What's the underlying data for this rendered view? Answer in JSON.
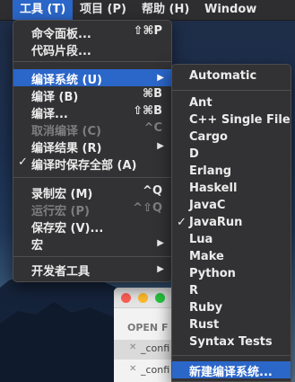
{
  "menubar": {
    "items": [
      {
        "label": "工具 (T)"
      },
      {
        "label": "项目 (P)"
      },
      {
        "label": "帮助 (H)"
      },
      {
        "label": "Window"
      }
    ]
  },
  "tools_menu": {
    "items": [
      {
        "label": "命令面板...",
        "shortcut": "⇧⌘P"
      },
      {
        "label": "代码片段..."
      },
      {
        "label": "编译系统 (U)"
      },
      {
        "label": "编译 (B)",
        "shortcut": "⌘B"
      },
      {
        "label": "编译...",
        "shortcut": "⇧⌘B"
      },
      {
        "label": "取消编译 (C)",
        "shortcut": "^C"
      },
      {
        "label": "编译结果 (R)"
      },
      {
        "label": "编译时保存全部 (A)"
      },
      {
        "label": "录制宏 (M)",
        "shortcut": "^Q"
      },
      {
        "label": "运行宏 (P)",
        "shortcut": "^⇧Q"
      },
      {
        "label": "保存宏 (V)..."
      },
      {
        "label": "宏"
      },
      {
        "label": "开发者工具"
      }
    ]
  },
  "build_menu": {
    "items": [
      {
        "label": "Automatic"
      },
      {
        "label": "Ant"
      },
      {
        "label": "C++ Single File"
      },
      {
        "label": "Cargo"
      },
      {
        "label": "D"
      },
      {
        "label": "Erlang"
      },
      {
        "label": "Haskell"
      },
      {
        "label": "JavaC"
      },
      {
        "label": "JavaRun"
      },
      {
        "label": "Lua"
      },
      {
        "label": "Make"
      },
      {
        "label": "Python"
      },
      {
        "label": "R"
      },
      {
        "label": "Ruby"
      },
      {
        "label": "Rust"
      },
      {
        "label": "Syntax Tests"
      },
      {
        "label": "新建编译系统..."
      }
    ]
  },
  "glyphs": {
    "check": "✓",
    "submenu_arrow": "▶",
    "close_x": "✕"
  },
  "bg_window": {
    "header": "OPEN F",
    "files": [
      {
        "name": "_confi"
      },
      {
        "name": "_confi"
      }
    ]
  },
  "colors": {
    "highlight": "#2b66c9",
    "menu_bg": "#323234",
    "menubar_bg": "#2e2e30"
  }
}
